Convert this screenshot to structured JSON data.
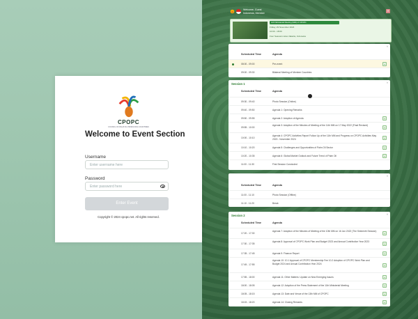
{
  "login": {
    "brand": "CPOPC",
    "brand_sub": "COUNCIL OF PALM OIL PRODUCING COUNTRIES",
    "title": "Welcome to Event Section",
    "username_label": "Username",
    "username_placeholder": "Enter username here",
    "password_label": "Password",
    "password_placeholder": "Enter password here",
    "submit_label": "Enter Event",
    "copyright": "Copyright © 2024 cpopc.net. All rights reserved."
  },
  "colors": {
    "accent": "#2e7d32",
    "button_disabled": "#d3d7da"
  },
  "topbar": {
    "title": "Welcome, Guest",
    "subtitle": "Indonesia, Member"
  },
  "event": {
    "title": "12th Ministerial Meeting (MM) of CPOPC",
    "date": "Friday, 29 November 2024",
    "time": "10:00 - 18:00",
    "venue": "Four Seasons Hotel Jakarta, Indonesia"
  },
  "table_headers": {
    "time": "Scheduled Time",
    "agenda": "Agenda"
  },
  "panel0": {
    "rows": [
      {
        "time": "08:00 - 09:00",
        "agenda": "Pre-event"
      },
      {
        "time": "09:00 - 09:30",
        "agenda": "Bilateral Meeting of Member Countries"
      }
    ]
  },
  "session1": {
    "label": "Session 1",
    "rows": [
      {
        "time": "09:30 - 09:40",
        "agenda": "Photo Session (Online)"
      },
      {
        "time": "09:40 - 09:50",
        "agenda": "Agenda 1: Opening Remarks"
      },
      {
        "time": "09:50 - 09:55",
        "agenda": "Agenda 2: Adoption of Agenda"
      },
      {
        "time": "09:55 - 10:00",
        "agenda": "Agenda 3: Adoption of the Minutes of Meeting of the 11th MM on 17 May 2022 (Final Revised)"
      },
      {
        "time": "10:00 - 10:10",
        "agenda": "Agenda 4: CPOPC Activities Report Follow Up of the 11th MM and Progress on CPOPC Activities May 2023 - November 2024"
      },
      {
        "time": "10:10 - 10:20",
        "agenda": "Agenda 5: Challenges and Opportunities of Palm Oil Sector"
      },
      {
        "time": "10:20 - 10:35",
        "agenda": "Agenda 6: Global Market Outlook and Future Trend of Palm Oil"
      },
      {
        "time": "11:00 - 11:30",
        "agenda": "First Session Concluded"
      }
    ]
  },
  "panel_break": {
    "rows": [
      {
        "time": "11:00 - 11:10",
        "agenda": "Photo Session (Offline)"
      },
      {
        "time": "11:10 - 11:20",
        "agenda": "Break"
      }
    ]
  },
  "session2": {
    "label": "Session 2",
    "rows": [
      {
        "time": "17:20 - 17:30",
        "agenda": "Agenda 7: Adoption of the Minutes of Meeting of the 10th MM on 16 Jun 2022 (The Sixteenth Session)"
      },
      {
        "time": "17:30 - 17:35",
        "agenda": "Agenda 8: Approval of CPOPC Work Plan and Budget 2023 and Annual Contribution Year 2023"
      },
      {
        "time": "17:35 - 17:45",
        "agenda": "Agenda 9: Finance Report"
      },
      {
        "time": "17:45 - 17:55",
        "agenda": "Agenda 10: 10.1 Approval of CPOPC Membership Fee 10.2 Adoption of CPOPC Work Plan and Budget 2024 and Annual Contribution Year 2024"
      },
      {
        "time": "17:55 - 18:00",
        "agenda": "Agenda 11: Other Matters: Update on New Emerging Issues"
      },
      {
        "time": "18:00 - 18:05",
        "agenda": "Agenda 12: Adoption of the Press Statement of the 11th Ministerial Meeting"
      },
      {
        "time": "18:05 - 18:15",
        "agenda": "Agenda 13: Date and Venue of the 13th MM of CPOPC"
      },
      {
        "time": "18:15 - 18:20",
        "agenda": "Agenda 14: Closing Remarks"
      }
    ]
  }
}
